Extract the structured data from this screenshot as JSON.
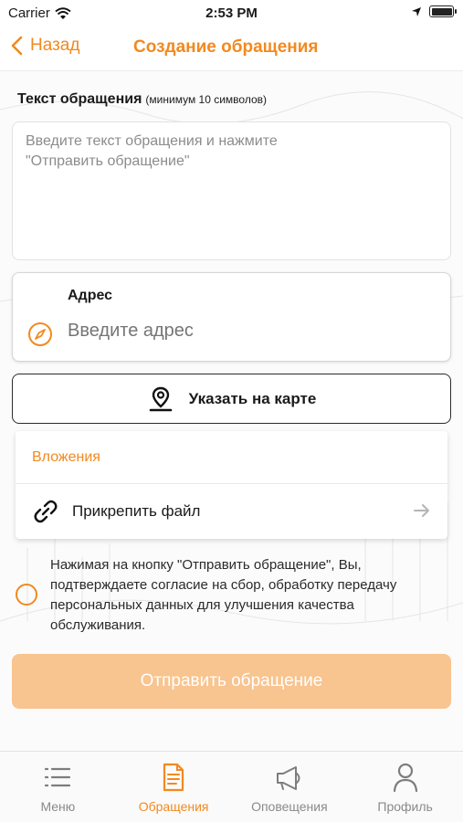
{
  "status_bar": {
    "carrier": "Carrier",
    "time": "2:53 PM"
  },
  "nav": {
    "back_label": "Назад",
    "title": "Создание обращения"
  },
  "text_section": {
    "label": "Текст обращения",
    "hint": "(минимум 10 символов)",
    "placeholder": "Введите текст обращения и нажмите\n\"Отправить обращение\""
  },
  "address": {
    "title": "Адрес",
    "placeholder": "Введите адрес",
    "icon": "compass-icon"
  },
  "map_button": {
    "label": "Указать на карте",
    "icon": "map-pin-icon"
  },
  "attachments": {
    "header": "Вложения",
    "attach_label": "Прикрепить файл",
    "icon": "paperclip-icon"
  },
  "consent": {
    "text": "Нажимая на кнопку \"Отправить обращение\", Вы, подтверждаете согласие на сбор, обработку передачу персональных данных для улучшения качества обслуживания.",
    "checked": false
  },
  "submit": {
    "label": "Отправить обращение",
    "enabled": false
  },
  "tabs": [
    {
      "label": "Меню",
      "icon": "list-icon",
      "active": false
    },
    {
      "label": "Обращения",
      "icon": "document-icon",
      "active": true
    },
    {
      "label": "Оповещения",
      "icon": "megaphone-icon",
      "active": false
    },
    {
      "label": "Профиль",
      "icon": "person-icon",
      "active": false
    }
  ],
  "colors": {
    "accent": "#f2891f",
    "submit_disabled": "#f8c48f",
    "placeholder": "#8f96b3"
  }
}
